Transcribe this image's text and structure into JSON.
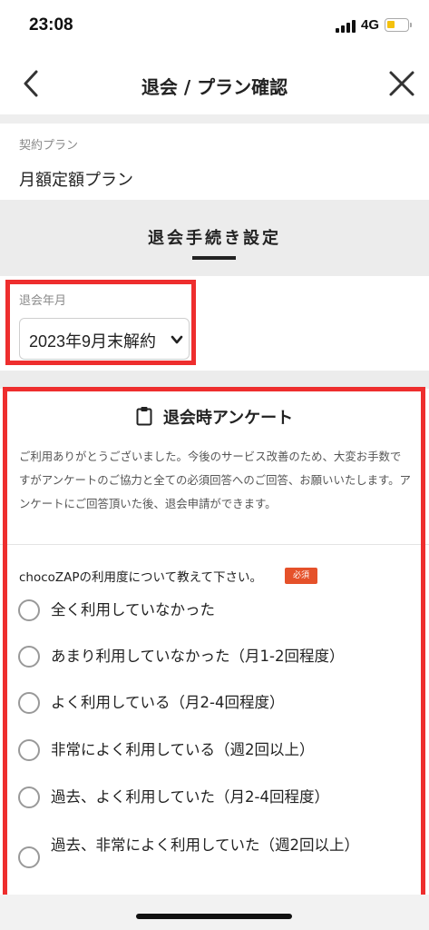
{
  "status_bar": {
    "time": "23:08",
    "network": "4G"
  },
  "header": {
    "title": "退会 / プラン確認",
    "back_icon": "chevron-left-icon",
    "close_icon": "close-icon"
  },
  "contract": {
    "label": "契約プラン",
    "value": "月額定額プラン"
  },
  "section": {
    "title": "退会手続き設定"
  },
  "cancel_month": {
    "label": "退会年月",
    "selected": "2023年9月末解約"
  },
  "survey": {
    "title": "退会時アンケート",
    "intro": "ご利用ありがとうございました。今後のサービス改善のため、大変お手数ですがアンケートのご協力と全ての必須回答へのご回答、お願いいたします。アンケートにご回答頂いた後、退会申請ができます。",
    "question": "chocoZAPの利用度について教えて下さい。",
    "required_badge": "必須",
    "options": [
      "全く利用していなかった",
      "あまり利用していなかった（月1-2回程度）",
      "よく利用している（月2-4回程度）",
      "非常によく利用している（週2回以上）",
      "過去、よく利用していた（月2-4回程度）",
      "過去、非常によく利用していた（週2回以上）"
    ]
  },
  "colors": {
    "highlight": "#ee2e2e",
    "required_badge": "#e5512a",
    "battery": "#f4c10d"
  }
}
